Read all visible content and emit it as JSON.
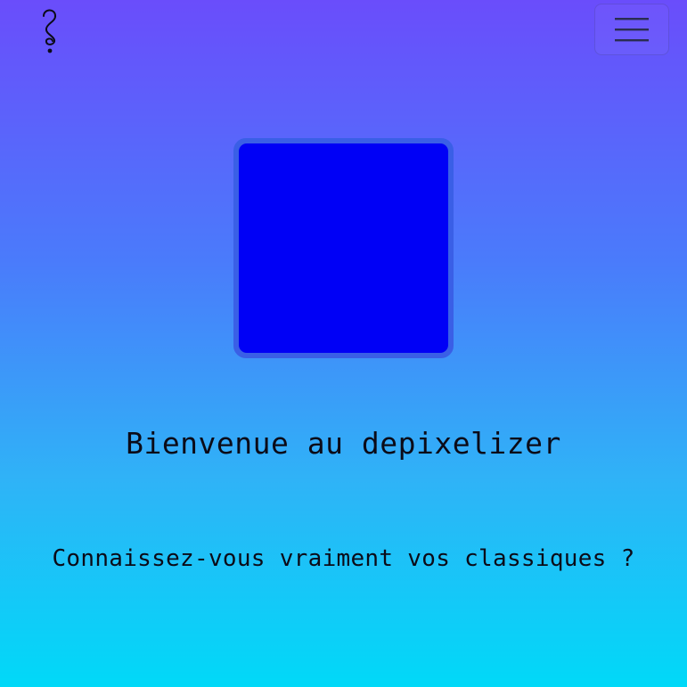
{
  "header": {
    "logo_icon": "treble-clef-question-icon",
    "menu_icon": "hamburger-menu-icon"
  },
  "main": {
    "image_color": "#0000f6",
    "welcome_text": "Bienvenue au depixelizer",
    "question_text": "Connaissez-vous vraiment vos classiques ?"
  },
  "colors": {
    "background_top": "#6a4dfb",
    "background_bottom": "#00d9f8",
    "frame_border": "#3a5fe6",
    "text": "#0b0b18"
  }
}
